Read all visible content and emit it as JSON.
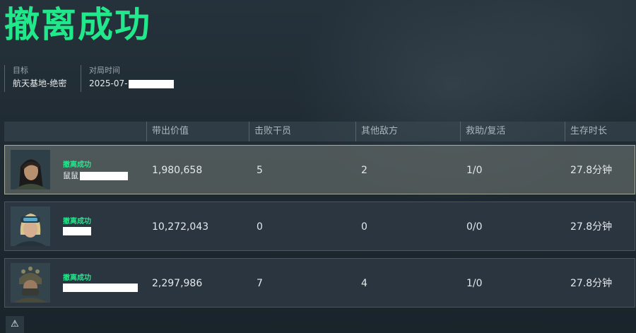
{
  "title": "撤离成功",
  "meta": {
    "target_label": "目标",
    "target_value": "航天基地-绝密",
    "time_label": "对局时间",
    "time_value": "2025-07-"
  },
  "headers": [
    "带出价值",
    "击败干员",
    "其他敌方",
    "救助/复活",
    "生存时长"
  ],
  "rows": [
    {
      "status": "撤离成功",
      "player": "鼠鼠",
      "value": "1,980,658",
      "kills": "5",
      "others": "2",
      "assists": "1/0",
      "survival": "27.8分钟"
    },
    {
      "status": "撤离成功",
      "player": "",
      "value": "10,272,043",
      "kills": "0",
      "others": "0",
      "assists": "0/0",
      "survival": "27.8分钟"
    },
    {
      "status": "撤离成功",
      "player": "",
      "value": "2,297,986",
      "kills": "7",
      "others": "4",
      "assists": "1/0",
      "survival": "27.8分钟"
    }
  ],
  "colors": {
    "accent": "#20e88b",
    "selected_row_border": "#a6ab9a"
  },
  "icons": {
    "warning": "warning-icon"
  }
}
